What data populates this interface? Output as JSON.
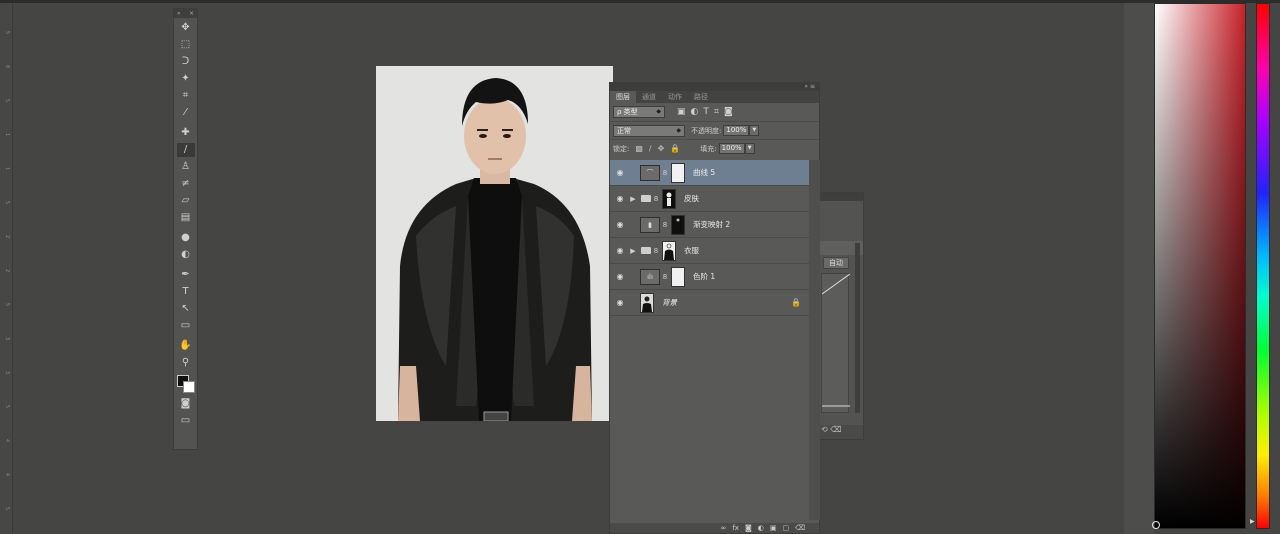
{
  "workspace": {
    "ruler_ticks": [
      "5",
      "0",
      "5",
      "1",
      "1",
      "5",
      "2",
      "2",
      "5",
      "3",
      "3",
      "5",
      "4",
      "4",
      "5"
    ]
  },
  "toolbox": {
    "header_left": "»",
    "header_right": "×",
    "tools": [
      {
        "name": "move-tool-icon",
        "glyph": "✥"
      },
      {
        "name": "marquee-tool-icon",
        "glyph": "⬚"
      },
      {
        "name": "lasso-tool-icon",
        "glyph": "ᑐ"
      },
      {
        "name": "magic-wand-tool-icon",
        "glyph": "✦"
      },
      {
        "name": "crop-tool-icon",
        "glyph": "⌗"
      },
      {
        "name": "eyedropper-tool-icon",
        "glyph": "⁄"
      },
      {
        "name": "healing-brush-tool-icon",
        "glyph": "✚"
      },
      {
        "name": "brush-tool-icon",
        "glyph": "/",
        "active": true
      },
      {
        "name": "clone-stamp-tool-icon",
        "glyph": "♙"
      },
      {
        "name": "history-brush-tool-icon",
        "glyph": "≠"
      },
      {
        "name": "eraser-tool-icon",
        "glyph": "▱"
      },
      {
        "name": "gradient-tool-icon",
        "glyph": "▤"
      },
      {
        "name": "blur-tool-icon",
        "glyph": "●"
      },
      {
        "name": "dodge-tool-icon",
        "glyph": "◐"
      },
      {
        "name": "pen-tool-icon",
        "glyph": "✒"
      },
      {
        "name": "type-tool-icon",
        "glyph": "T"
      },
      {
        "name": "path-selection-tool-icon",
        "glyph": "↖"
      },
      {
        "name": "rectangle-tool-icon",
        "glyph": "▭"
      },
      {
        "name": "hand-tool-icon",
        "glyph": "✋"
      },
      {
        "name": "zoom-tool-icon",
        "glyph": "⚲"
      }
    ],
    "bottom_tools": [
      {
        "name": "quick-mask-icon",
        "glyph": "◙"
      },
      {
        "name": "screen-mode-icon",
        "glyph": "▭"
      }
    ]
  },
  "layers_panel": {
    "collapse_label": "»  ≡",
    "tabs": [
      "图层",
      "通道",
      "动作",
      "路径"
    ],
    "filter_select": "ρ 类型",
    "filter_icons": [
      "▣",
      "◐",
      "T",
      "⌗",
      "◙"
    ],
    "blend_mode": "正常",
    "opacity_label": "不透明度:",
    "opacity_value": "100%",
    "lock_label": "锁定:",
    "lock_icons": [
      "▩",
      "/",
      "✥",
      "🔒"
    ],
    "fill_label": "填充:",
    "fill_value": "100%",
    "layers": [
      {
        "name": "曲线 5",
        "selected": true,
        "kind": "adjustment",
        "adj_glyph": "⌒",
        "has_folder": false,
        "mask": "white",
        "link": "8"
      },
      {
        "name": "皮肤",
        "selected": false,
        "kind": "group",
        "has_folder": true,
        "mask": "black",
        "link": "8"
      },
      {
        "name": "渐变映射 2",
        "selected": false,
        "kind": "adjustment",
        "adj_glyph": "▮",
        "has_folder": false,
        "mask": "black",
        "link": "8"
      },
      {
        "name": "衣服",
        "selected": false,
        "kind": "group",
        "has_folder": true,
        "mask": "white",
        "link": "8"
      },
      {
        "name": "色阶 1",
        "selected": false,
        "kind": "adjustment",
        "adj_glyph": "ılı",
        "has_folder": false,
        "mask": "white",
        "link": "8"
      },
      {
        "name": "背景",
        "selected": false,
        "kind": "background",
        "has_folder": false,
        "locked": true,
        "lock_glyph": "🔒"
      }
    ],
    "footer_icons": [
      "∞",
      "fx",
      "◙",
      "◐",
      "▣",
      "▢",
      "⌫"
    ]
  },
  "properties_panel": {
    "auto_button": "自动",
    "footer_icons": "⟲ ⌫"
  },
  "colors": {
    "workspace": "#454543",
    "selected_layer": "#6f7f92",
    "picker_hue": "#c8222a"
  }
}
